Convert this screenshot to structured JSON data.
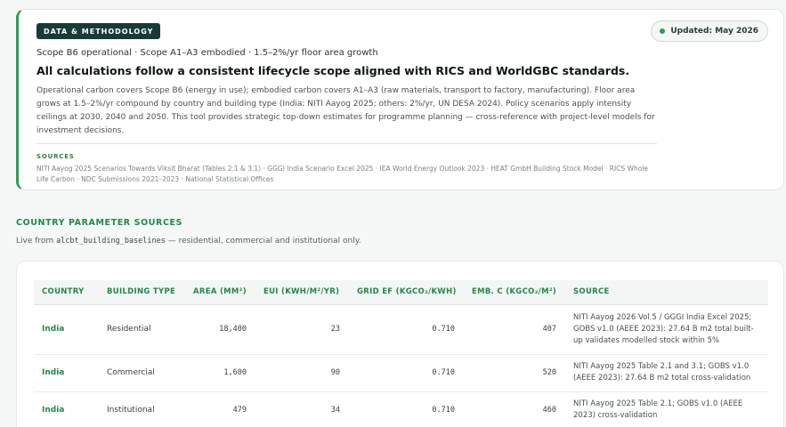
{
  "methodology": {
    "chip": "DATA & METHODOLOGY",
    "updated": "Updated: May 2026",
    "scope_line": "Scope B6 operational · Scope A1–A3 embodied · 1.5–2%/yr floor area growth",
    "headline": "All calculations follow a consistent lifecycle scope aligned with RICS and WorldGBC standards.",
    "paragraph": "Operational carbon covers Scope B6 (energy in use); embodied carbon covers A1–A3 (raw materials, transport to factory, manufacturing). Floor area grows at 1.5–2%/yr compound by country and building type (India: NITI Aayog 2025; others: 2%/yr, UN DESA 2024). Policy scenarios apply intensity ceilings at 2030, 2040 and 2050. This tool provides strategic top-down estimates for programme planning — cross-reference with project-level models for investment decisions.",
    "sources_title": "SOURCES",
    "sources_text": "NITI Aayog 2025 Scenarios Towards Viksit Bharat (Tables 2.1 & 3.1) · GGGI India Scenario Excel 2025 · IEA World Energy Outlook 2023 · HEAT GmbH Building Stock Model · RICS Whole Life Carbon · NDC Submissions 2021–2023 · National Statistical Offices"
  },
  "country_sources": {
    "title": "COUNTRY PARAMETER SOURCES",
    "subtitle_prefix": "Live from",
    "subtitle_code": "alcbt_building_baselines",
    "subtitle_suffix": "— residential, commercial and institutional only.",
    "columns": [
      "COUNTRY",
      "BUILDING TYPE",
      "AREA (MM²)",
      "EUI (KWH/M²/YR)",
      "GRID EF (KGCO₂/KWH)",
      "EMB. C (KGCO₂/M²)",
      "SOURCE"
    ],
    "rows": [
      {
        "country": "India",
        "type": "Residential",
        "area": "18,400",
        "eui": "23",
        "grid_ef": "0.710",
        "emb_c": "407",
        "source": "NITI Aayog 2026 Vol.5 / GGGI India Excel 2025; GOBS v1.0 (AEEE 2023): 27.64 B m2 total built-up validates modelled stock within 5%"
      },
      {
        "country": "India",
        "type": "Commercial",
        "area": "1,600",
        "eui": "90",
        "grid_ef": "0.710",
        "emb_c": "520",
        "source": "NITI Aayog 2025 Table 2.1 and 3.1; GOBS v1.0 (AEEE 2023): 27.64 B m2 total cross-validation"
      },
      {
        "country": "India",
        "type": "Institutional",
        "area": "479",
        "eui": "34",
        "grid_ef": "0.710",
        "emb_c": "460",
        "source": "NITI Aayog 2025 Table 2.1; GOBS v1.0 (AEEE 2023) cross-validation"
      }
    ]
  },
  "colors": {
    "accent_green": "#1f8a47",
    "chip_bg": "#183a3a",
    "status_dot": "#2e9b55"
  }
}
